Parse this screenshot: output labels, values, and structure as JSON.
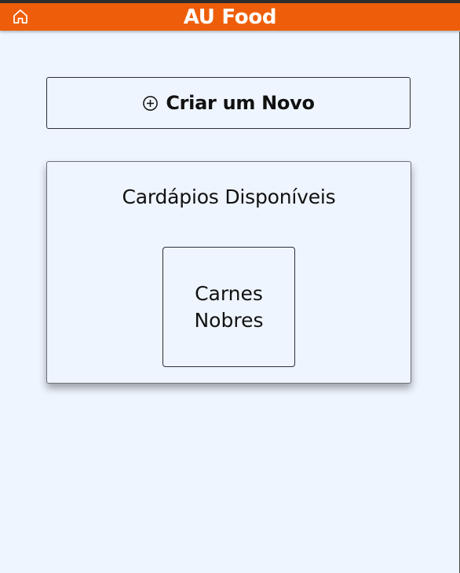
{
  "header": {
    "title": "AU Food",
    "home_icon": "home-icon",
    "background_color": "#ee5e0a"
  },
  "create_button": {
    "icon": "plus-circle-icon",
    "label": "Criar um Novo"
  },
  "menus_panel": {
    "title": "Cardápios Disponíveis",
    "items": [
      {
        "label": "Carnes Nobres"
      }
    ]
  },
  "colors": {
    "page_background": "#eef5fe",
    "accent": "#ee5e0a",
    "text": "#111111"
  }
}
